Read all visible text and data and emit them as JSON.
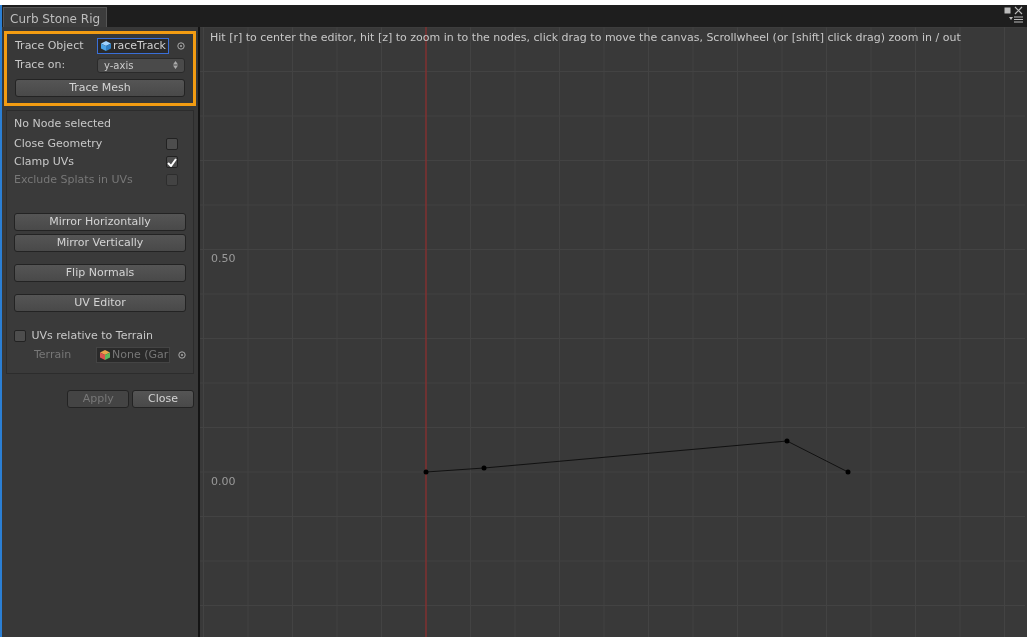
{
  "window": {
    "title": "Curb Stone Rig"
  },
  "trace": {
    "highlighted": true,
    "object_label": "Trace Object",
    "object_value": "raceTrack",
    "object_focused": true,
    "on_label": "Trace on:",
    "on_value": "y-axis",
    "button": "Trace Mesh"
  },
  "node_status": "No Node selected",
  "options": [
    {
      "label": "Close Geometry",
      "checked": false,
      "disabled": false
    },
    {
      "label": "Clamp UVs",
      "checked": true,
      "disabled": false
    },
    {
      "label": "Exclude Splats in UVs",
      "checked": false,
      "disabled": true
    }
  ],
  "action_groups": [
    [
      "Mirror Horizontally",
      "Mirror Vertically"
    ],
    [
      "Flip Normals"
    ],
    [
      "UV Editor"
    ]
  ],
  "terrain": {
    "label": "UVs relative to Terrain",
    "checked": false,
    "field_label": "Terrain",
    "field_value": "None (Gar",
    "disabled": true
  },
  "footer": [
    {
      "label": "Apply",
      "disabled": true
    },
    {
      "label": "Close",
      "disabled": false
    }
  ],
  "canvas": {
    "hint": "Hit [r] to center the editor, hit [z] to zoom in to the nodes, click drag to move the canvas, Scrollwheel (or [shift] click drag) zoom in / out",
    "axis_labels": [
      "0.50",
      "0.00"
    ]
  }
}
